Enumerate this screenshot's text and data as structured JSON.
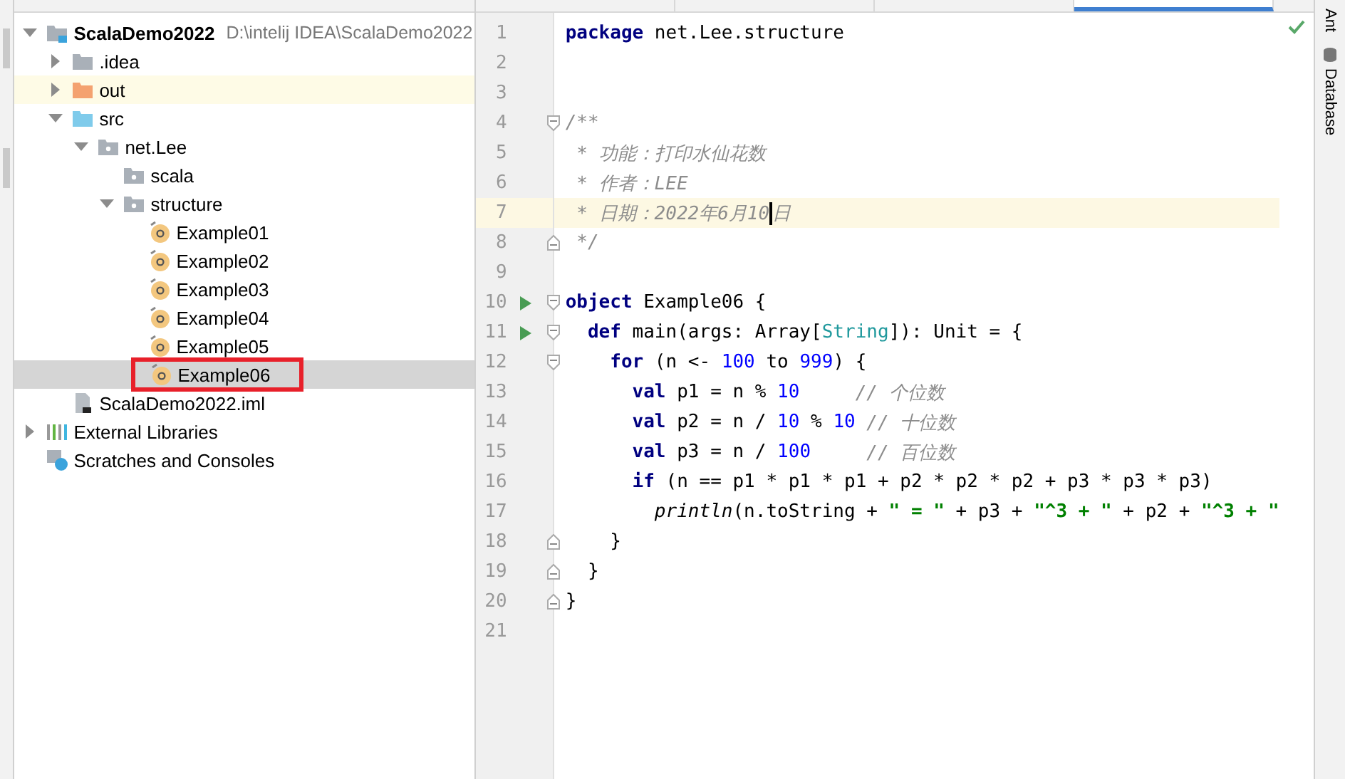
{
  "project_tree": [
    {
      "name": "ScalaDemo2022",
      "path": "D:\\intelij IDEA\\ScalaDemo2022",
      "kind": "module",
      "expanded": true,
      "selected": false,
      "hovered": false,
      "marked": false,
      "children": [
        {
          "name": ".idea",
          "kind": "folder",
          "expanded": false,
          "selected": false,
          "hovered": false,
          "marked": false
        },
        {
          "name": "out",
          "kind": "excluded",
          "expanded": false,
          "selected": false,
          "hovered": true,
          "marked": false
        },
        {
          "name": "src",
          "kind": "source",
          "expanded": true,
          "selected": false,
          "hovered": false,
          "marked": false,
          "children": [
            {
              "name": "net.Lee",
              "kind": "package",
              "expanded": true,
              "selected": false,
              "hovered": false,
              "marked": false,
              "children": [
                {
                  "name": "scala",
                  "kind": "package",
                  "selected": false,
                  "hovered": false,
                  "marked": false
                },
                {
                  "name": "structure",
                  "kind": "package",
                  "expanded": true,
                  "selected": false,
                  "hovered": false,
                  "marked": false,
                  "children": [
                    {
                      "name": "Example01",
                      "kind": "object",
                      "selected": false,
                      "hovered": false,
                      "marked": false
                    },
                    {
                      "name": "Example02",
                      "kind": "object",
                      "selected": false,
                      "hovered": false,
                      "marked": false
                    },
                    {
                      "name": "Example03",
                      "kind": "object",
                      "selected": false,
                      "hovered": false,
                      "marked": false
                    },
                    {
                      "name": "Example04",
                      "kind": "object",
                      "selected": false,
                      "hovered": false,
                      "marked": false
                    },
                    {
                      "name": "Example05",
                      "kind": "object",
                      "selected": false,
                      "hovered": false,
                      "marked": false
                    },
                    {
                      "name": "Example06",
                      "kind": "object",
                      "selected": true,
                      "hovered": false,
                      "marked": true
                    }
                  ]
                }
              ]
            }
          ]
        },
        {
          "name": "ScalaDemo2022.iml",
          "kind": "file",
          "selected": false,
          "hovered": false,
          "marked": false
        }
      ]
    },
    {
      "name": "External Libraries",
      "kind": "libraries",
      "expanded": false,
      "selected": false,
      "hovered": false,
      "marked": false
    },
    {
      "name": "Scratches and Consoles",
      "kind": "scratches",
      "selected": false,
      "hovered": false,
      "marked": false
    }
  ],
  "editor_tabs": [
    {
      "selected": false
    },
    {
      "selected": false
    },
    {
      "selected": false
    },
    {
      "selected": true
    }
  ],
  "code_lines": [
    {
      "number": "1",
      "run": false,
      "fold_start": false,
      "fold_end": false,
      "current": false,
      "tokens": [
        {
          "kind": "keyword",
          "text": "package"
        },
        {
          "kind": "plain",
          "text": " net.Lee.structure"
        }
      ]
    },
    {
      "number": "2",
      "run": false,
      "fold_start": false,
      "fold_end": false,
      "current": false
    },
    {
      "number": "3",
      "run": false,
      "fold_start": false,
      "fold_end": false,
      "current": false
    },
    {
      "number": "4",
      "run": false,
      "fold_start": true,
      "fold_end": false,
      "current": false,
      "tokens": [
        {
          "kind": "comment",
          "text": "/**"
        }
      ]
    },
    {
      "number": "5",
      "run": false,
      "fold_start": false,
      "fold_end": false,
      "current": false,
      "tokens": [
        {
          "kind": "comment",
          "text": " * 功能：打印水仙花数"
        }
      ]
    },
    {
      "number": "6",
      "run": false,
      "fold_start": false,
      "fold_end": false,
      "current": false,
      "tokens": [
        {
          "kind": "comment",
          "text": " * 作者：LEE"
        }
      ]
    },
    {
      "number": "7",
      "run": false,
      "fold_start": false,
      "fold_end": false,
      "current": true,
      "tokens": [
        {
          "kind": "comment",
          "text": " * 日期：2022年6月10",
          "caret": true
        },
        {
          "kind": "comment",
          "text": "日",
          "caret": false
        }
      ]
    },
    {
      "number": "8",
      "run": false,
      "fold_start": false,
      "fold_end": true,
      "current": false,
      "tokens": [
        {
          "kind": "comment",
          "text": " */"
        }
      ]
    },
    {
      "number": "9",
      "run": false,
      "fold_start": false,
      "fold_end": false,
      "current": false
    },
    {
      "number": "10",
      "run": true,
      "fold_start": true,
      "fold_end": false,
      "current": false,
      "tokens": [
        {
          "kind": "keyword",
          "text": "object"
        },
        {
          "kind": "plain",
          "text": " Example06 {"
        }
      ]
    },
    {
      "number": "11",
      "run": true,
      "fold_start": true,
      "fold_end": false,
      "current": false,
      "tokens": [
        {
          "kind": "keyword",
          "text": "  def"
        },
        {
          "kind": "plain",
          "text": " main(args: Array["
        },
        {
          "kind": "type",
          "text": "String"
        },
        {
          "kind": "plain",
          "text": "]): Unit = {"
        }
      ]
    },
    {
      "number": "12",
      "run": false,
      "fold_start": true,
      "fold_end": false,
      "current": false,
      "tokens": [
        {
          "kind": "keyword",
          "text": "    for"
        },
        {
          "kind": "plain",
          "text": " (n <- "
        },
        {
          "kind": "number",
          "text": "100"
        },
        {
          "kind": "plain",
          "text": " to "
        },
        {
          "kind": "number",
          "text": "999"
        },
        {
          "kind": "plain",
          "text": ") {"
        }
      ]
    },
    {
      "number": "13",
      "run": false,
      "fold_start": false,
      "fold_end": false,
      "current": false,
      "tokens": [
        {
          "kind": "keyword",
          "text": "      val"
        },
        {
          "kind": "plain",
          "text": " p1 = n % "
        },
        {
          "kind": "number",
          "text": "10"
        },
        {
          "kind": "comment",
          "text": "     // 个位数"
        }
      ]
    },
    {
      "number": "14",
      "run": false,
      "fold_start": false,
      "fold_end": false,
      "current": false,
      "tokens": [
        {
          "kind": "keyword",
          "text": "      val"
        },
        {
          "kind": "plain",
          "text": " p2 = n / "
        },
        {
          "kind": "number",
          "text": "10"
        },
        {
          "kind": "plain",
          "text": " % "
        },
        {
          "kind": "number",
          "text": "10"
        },
        {
          "kind": "comment",
          "text": " // 十位数"
        }
      ]
    },
    {
      "number": "15",
      "run": false,
      "fold_start": false,
      "fold_end": false,
      "current": false,
      "tokens": [
        {
          "kind": "keyword",
          "text": "      val"
        },
        {
          "kind": "plain",
          "text": " p3 = n / "
        },
        {
          "kind": "number",
          "text": "100"
        },
        {
          "kind": "comment",
          "text": "     // 百位数"
        }
      ]
    },
    {
      "number": "16",
      "run": false,
      "fold_start": false,
      "fold_end": false,
      "current": false,
      "tokens": [
        {
          "kind": "keyword",
          "text": "      if"
        },
        {
          "kind": "plain",
          "text": " (n == p1 * p1 * p1 + p2 * p2 * p2 + p3 * p3 * p3)"
        }
      ]
    },
    {
      "number": "17",
      "run": false,
      "fold_start": false,
      "fold_end": false,
      "current": false,
      "tokens": [
        {
          "kind": "call",
          "text": "        println"
        },
        {
          "kind": "plain",
          "text": "(n.toString + "
        },
        {
          "kind": "string",
          "text": "\" = \""
        },
        {
          "kind": "plain",
          "text": " + p3 + "
        },
        {
          "kind": "string",
          "text": "\"^3 + \""
        },
        {
          "kind": "plain",
          "text": " + p2 + "
        },
        {
          "kind": "string",
          "text": "\"^3 + \""
        }
      ]
    },
    {
      "number": "18",
      "run": false,
      "fold_start": false,
      "fold_end": true,
      "current": false,
      "tokens": [
        {
          "kind": "plain",
          "text": "    }"
        }
      ]
    },
    {
      "number": "19",
      "run": false,
      "fold_start": false,
      "fold_end": true,
      "current": false,
      "tokens": [
        {
          "kind": "plain",
          "text": "  }"
        }
      ]
    },
    {
      "number": "20",
      "run": false,
      "fold_start": false,
      "fold_end": true,
      "current": false,
      "tokens": [
        {
          "kind": "plain",
          "text": "}"
        }
      ]
    },
    {
      "number": "21",
      "run": false,
      "fold_start": false,
      "fold_end": false,
      "current": false
    }
  ],
  "inspection_ok": true,
  "right_tool_windows": [
    {
      "label": "Ant",
      "kind": "plain"
    },
    {
      "label": "Database",
      "kind": "database"
    }
  ]
}
